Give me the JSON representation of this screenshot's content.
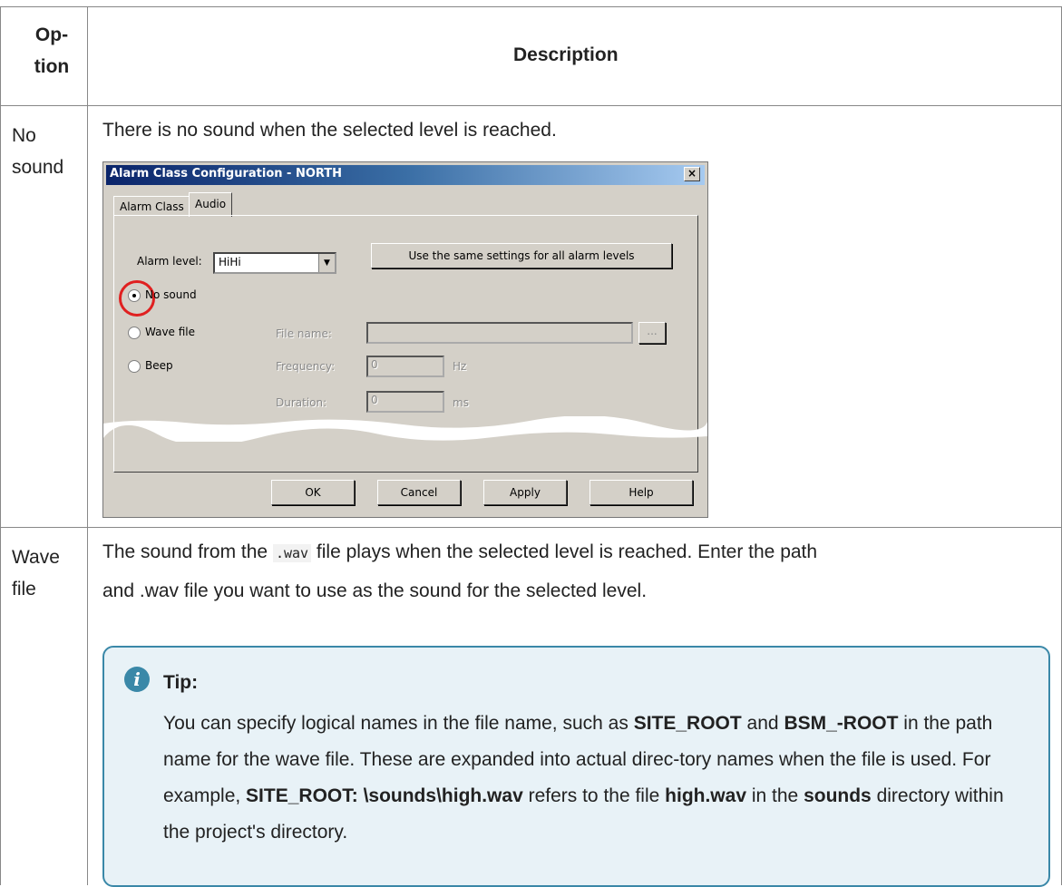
{
  "table": {
    "header_option": "Op-\ntion",
    "header_description": "Description"
  },
  "rows": [
    {
      "option": "No\nsound",
      "description": "There is no sound when the selected level is reached."
    },
    {
      "option": "Wave\nfile",
      "description_pre": "The sound from the ",
      "description_code": ".wav",
      "description_post": " file plays when the selected level is reached. Enter the path",
      "description_line2": "and .wav file you want to use as the sound for the selected level."
    }
  ],
  "dialog": {
    "title": "Alarm Class Configuration - NORTH",
    "close_label": "×",
    "tabs": [
      "Alarm Class",
      "Audio"
    ],
    "alarm_level_label": "Alarm level:",
    "alarm_level_value": "HiHi",
    "same_settings_button": "Use the same settings for all alarm levels",
    "radio_no_sound": "No sound",
    "radio_wave_file": "Wave file",
    "radio_beep": "Beep",
    "file_name_label": "File name:",
    "browse_label": "...",
    "frequency_label": "Frequency:",
    "frequency_value": "0",
    "hz_label": "Hz",
    "duration_label": "Duration:",
    "duration_value": "0",
    "ms_label": "ms",
    "buttons": {
      "ok": "OK",
      "cancel": "Cancel",
      "apply": "Apply",
      "help": "Help"
    }
  },
  "tip": {
    "title": "Tip:",
    "icon_char": "i"
  },
  "colors": {
    "tip_border": "#3a88a8",
    "tip_background": "#e8f2f7",
    "highlight_circle": "#e02020",
    "titlebar_start": "#0a246a"
  }
}
